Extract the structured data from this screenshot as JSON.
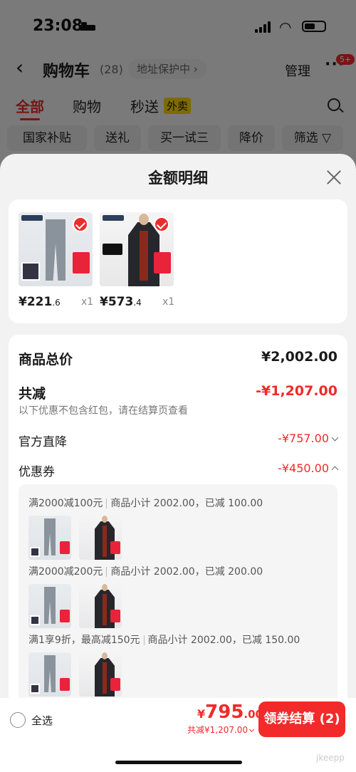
{
  "status_bar": {
    "time": "23:08"
  },
  "nav": {
    "back_icon": "chevron-left-icon",
    "title": "购物车",
    "count": "(28)",
    "protect": "地址保护中 ›",
    "manage": "管理",
    "more": "···",
    "badge": "5+"
  },
  "tabs": [
    {
      "label": "全部"
    },
    {
      "label": "购物"
    },
    {
      "label": "秒送"
    }
  ],
  "tab_tag": "外卖",
  "chips": [
    {
      "label": "国家补贴"
    },
    {
      "label": "送礼"
    },
    {
      "label": "买一试三"
    },
    {
      "label": "降价"
    },
    {
      "label": "筛选 ▽"
    }
  ],
  "sheet": {
    "title": "金额明细",
    "products": [
      {
        "price_main": "¥221",
        "price_dec": ".6",
        "qty": "x1"
      },
      {
        "price_main": "¥573",
        "price_dec": ".4",
        "qty": "x1"
      }
    ],
    "summary": {
      "total_label": "商品总价",
      "total_value": "¥2,002.00",
      "reduce_label": "共减",
      "reduce_value": "-¥1,207.00",
      "note": "以下优惠不包含红包，请在结算页查看",
      "official_label": "官方直降",
      "official_value": "-¥757.00",
      "coupon_label": "优惠券",
      "coupon_value": "-¥450.00"
    },
    "coupons": [
      {
        "rule": "满2000减100元",
        "detail": "商品小计 2002.00，已减 100.00"
      },
      {
        "rule": "满2000减200元",
        "detail": "商品小计 2002.00，已减 200.00"
      },
      {
        "rule": "满1享9折，最高减150元",
        "detail": "商品小计 2002.00，已减 150.00"
      }
    ]
  },
  "bottom": {
    "select_all": "全选",
    "currency": "¥",
    "amount_int": "795",
    "amount_dec": ".00",
    "reduce": "共减¥1,207.00",
    "checkout": "领券结算 (2)",
    "watermark": "jkeepp"
  }
}
